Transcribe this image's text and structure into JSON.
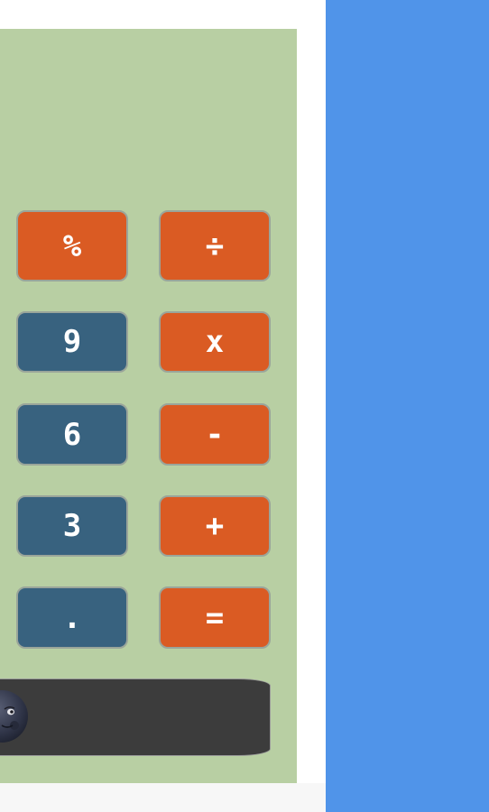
{
  "keypad": {
    "row1": {
      "left": "%",
      "right": "÷"
    },
    "row2": {
      "left": "9",
      "right": "x"
    },
    "row3": {
      "left": "6",
      "right": "-"
    },
    "row4": {
      "left": "3",
      "right": "+"
    },
    "row5": {
      "left": ".",
      "right": "="
    }
  },
  "theme_toggle": {
    "icon": "moon-face-icon"
  },
  "colors": {
    "calculator_background": "#b8cfa3",
    "operator_key": "#da5b23",
    "number_key": "#38627f",
    "side_panel": "#5094e9",
    "toggle_bar": "#3c3c3c"
  }
}
